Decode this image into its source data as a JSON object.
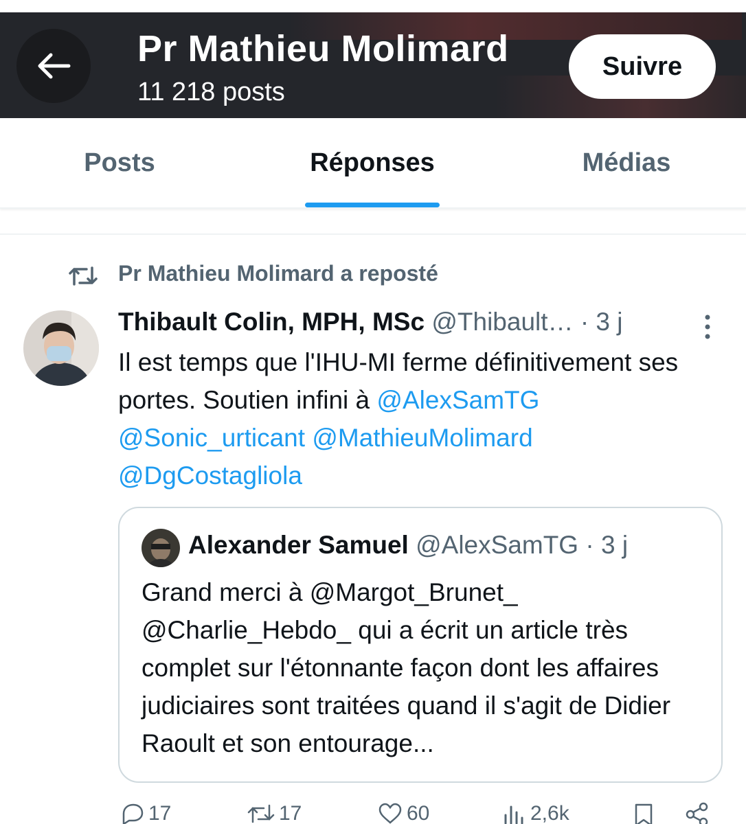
{
  "header": {
    "title": "Pr Mathieu Molimard",
    "post_count": "11 218 posts",
    "follow_label": "Suivre",
    "colors": {
      "background": "#24262b",
      "text": "#ffffff"
    }
  },
  "tabs": [
    {
      "label": "Posts",
      "active": false
    },
    {
      "label": "Réponses",
      "active": true
    },
    {
      "label": "Médias",
      "active": false
    }
  ],
  "repost": {
    "text": "Pr Mathieu Molimard a reposté",
    "icon": "repost-icon"
  },
  "tweet": {
    "author_name": "Thibault Colin, MPH, MSc",
    "author_handle": "@Thibault…",
    "time": "· 3 j",
    "text_plain": "Il est temps que l'IHU-MI ferme définitivement ses portes. Soutien infini à ",
    "mentions": [
      "@AlexSamTG",
      "@Sonic_urticant",
      "@MathieuMolimard",
      "@DgCostagliola"
    ]
  },
  "quote": {
    "author_name": "Alexander Samuel",
    "author_handle": "@AlexSamTG",
    "time": "· 3 j",
    "text_before": "Grand merci à ",
    "mention1": "@Margot_Brunet_",
    "mention2": "@Charlie_Hebdo_",
    "text_after": " qui a écrit un article très complet sur l'étonnante façon dont les affaires judiciaires sont traitées quand il s'agit de Didier Raoult et son entourage..."
  },
  "actions": {
    "replies": "17",
    "reposts": "17",
    "likes": "60",
    "views": "2,6k"
  },
  "colors": {
    "accent": "#1d9bf0",
    "secondary_text": "#536471",
    "primary_text": "#0f1419",
    "border": "#cfd9de"
  }
}
